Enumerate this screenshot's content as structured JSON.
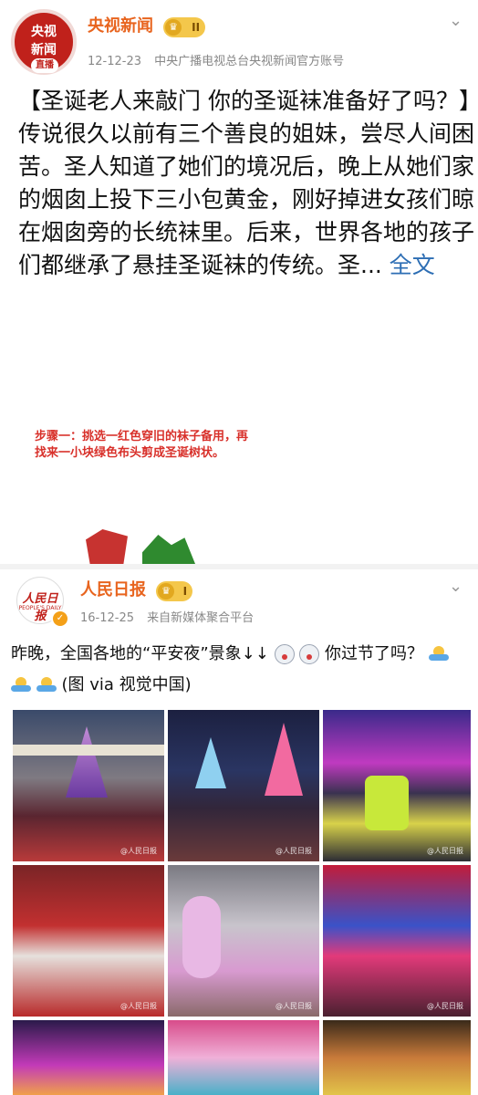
{
  "post1": {
    "account_name": "央视新闻",
    "avatar_line1": "央视",
    "avatar_line2": "新闻",
    "avatar_badge": "直播",
    "level_badge": "II",
    "date": "12-12-23",
    "source": "中央广播电视总台央视新闻官方账号",
    "body_text": "【圣诞老人来敲门 你的圣诞袜准备好了吗？】传说很久以前有三个善良的姐妹，尝尽人间困苦。圣人知道了她们的境况后，晚上从她们家的烟囱上投下三小包黄金，刚好掉进女孩们晾在烟囱旁的长统袜里。后来，世界各地的孩子们都继承了悬挂圣诞袜的传统。圣...",
    "full_text_link": "全文",
    "image_caption": "步骤一：挑选一红色穿旧的袜子备用，再找来一小块绿色布头剪成圣诞树状。"
  },
  "post2": {
    "account_name": "人民日报",
    "avatar_text": "人民日报",
    "avatar_sub": "PEOPLE'S DAILY",
    "level_badge": "I",
    "date": "16-12-25",
    "source": "来自新媒体聚合平台",
    "text_part1": "昨晚，全国各地的“平安夜”景象↓↓",
    "text_part2": "你过节了吗？",
    "text_part3": "(图 via 视觉中国)",
    "watermark": "@人民日报"
  },
  "icons": {
    "menu": "chevron-down-icon",
    "emoji_face": "shocked-face-emoji-icon",
    "emoji_shrug": "shrug-emoji-icon"
  },
  "colors": {
    "name_orange": "#e8641e",
    "link_blue": "#2d6eb4",
    "badge_gold": "#f4c74b",
    "caption_red": "#d8302a"
  }
}
